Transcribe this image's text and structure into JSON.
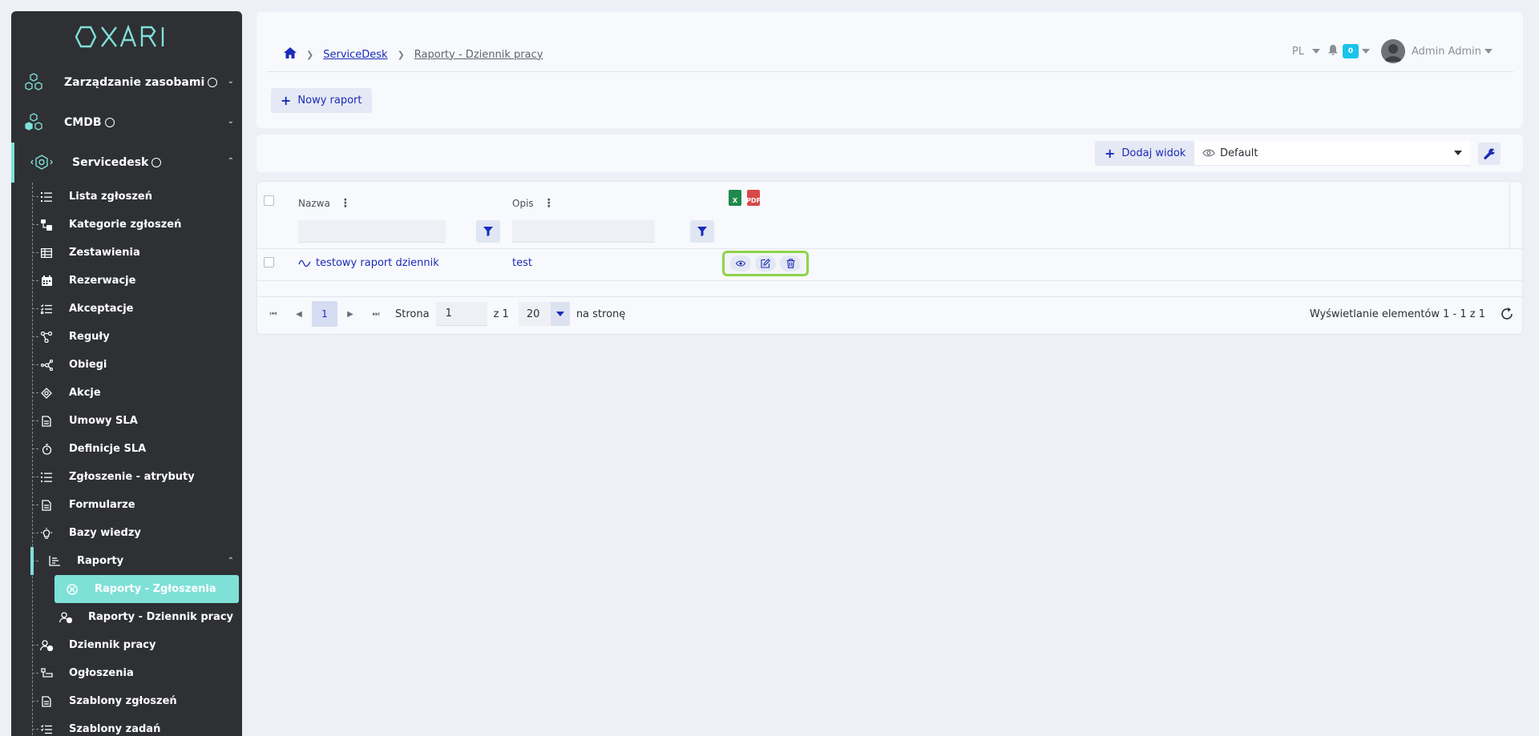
{
  "app": {
    "logo": "OXARI"
  },
  "sidebar": {
    "top_items": [
      {
        "label": "Zarządzanie zasobami"
      },
      {
        "label": "CMDB"
      },
      {
        "label": "Servicedesk"
      }
    ],
    "servicedesk_items": [
      {
        "label": "Lista zgłoszeń"
      },
      {
        "label": "Kategorie zgłoszeń"
      },
      {
        "label": "Zestawienia"
      },
      {
        "label": "Rezerwacje"
      },
      {
        "label": "Akceptacje"
      },
      {
        "label": "Reguły"
      },
      {
        "label": "Obiegi"
      },
      {
        "label": "Akcje"
      },
      {
        "label": "Umowy SLA"
      },
      {
        "label": "Definicje SLA"
      },
      {
        "label": "Zgłoszenie - atrybuty"
      },
      {
        "label": "Formularze"
      },
      {
        "label": "Bazy wiedzy"
      }
    ],
    "reports_group": {
      "label": "Raporty"
    },
    "reports_items": [
      {
        "label": "Raporty - Zgłoszenia"
      },
      {
        "label": "Raporty - Dziennik pracy"
      }
    ],
    "after_items": [
      {
        "label": "Dziennik pracy"
      },
      {
        "label": "Ogłoszenia"
      },
      {
        "label": "Szablony zgłoszeń"
      },
      {
        "label": "Szablony zadań"
      }
    ],
    "accent_color": "#7fe0d8"
  },
  "header": {
    "breadcrumb": [
      "ServiceDesk",
      "Raporty - Dziennik pracy"
    ],
    "language": "PL",
    "notifications_count": "0",
    "user_name": "Admin Admin",
    "new_report_label": "Nowy raport"
  },
  "views": {
    "add_view_label": "Dodaj widok",
    "selected_view": "Default"
  },
  "grid": {
    "columns": [
      {
        "label": "Nazwa"
      },
      {
        "label": "Opis"
      }
    ],
    "rows": [
      {
        "name": "testowy raport dziennik",
        "description": "test"
      }
    ]
  },
  "pager": {
    "current_page": "1",
    "page_label": "Strona",
    "page_value": "1",
    "of_label": "z 1",
    "page_size": "20",
    "per_page_label": "na stronę",
    "info": "Wyświetlanie elementów 1 - 1 z 1"
  }
}
